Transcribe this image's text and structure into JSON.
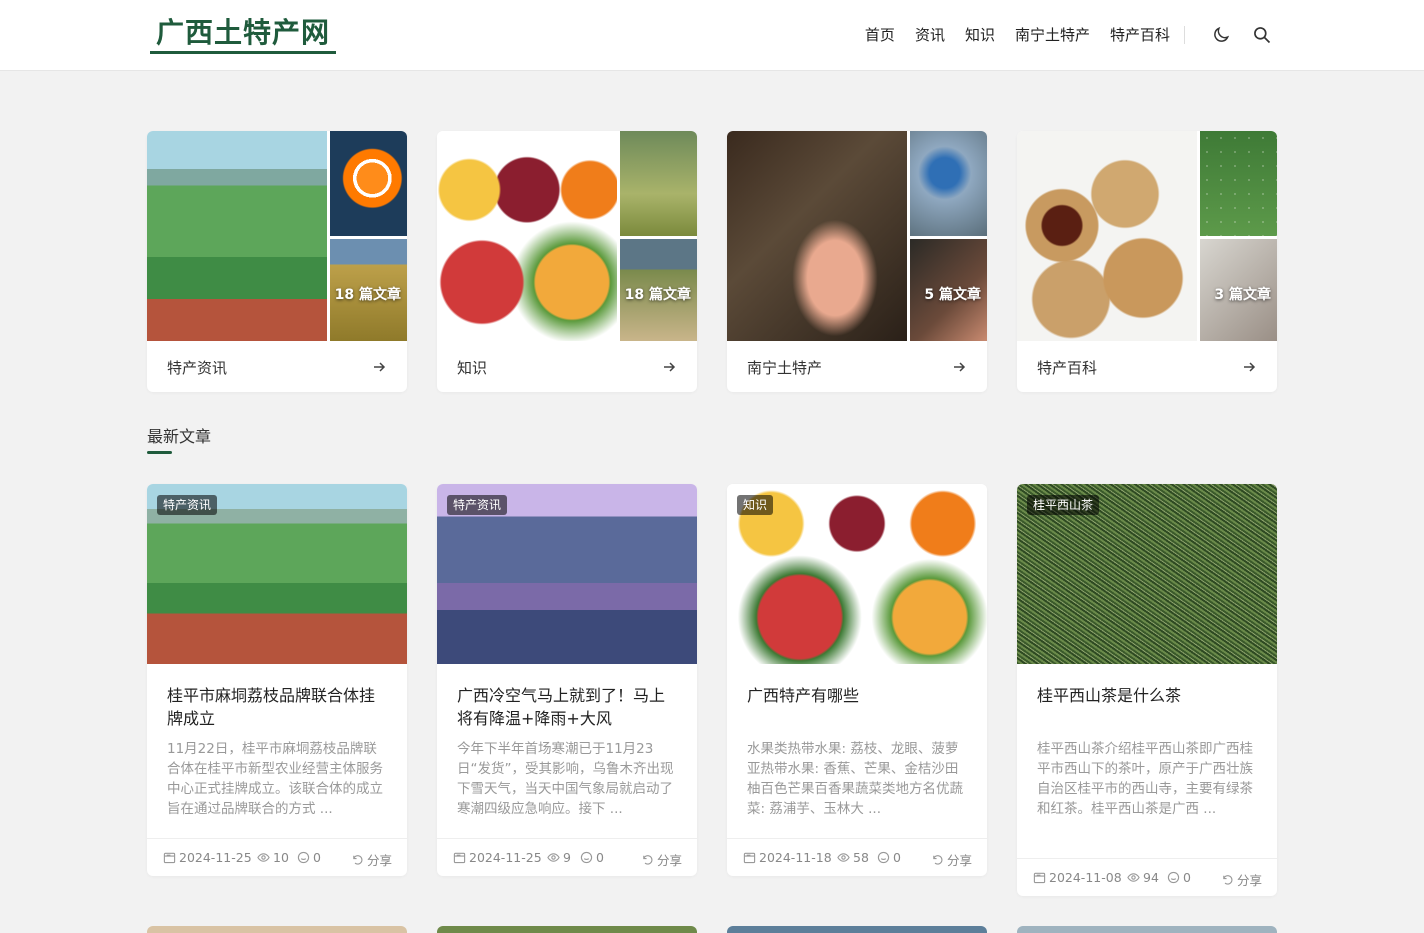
{
  "site": {
    "logo": "广西土特产网",
    "nav": [
      "首页",
      "资讯",
      "知识",
      "南宁土特产",
      "特产百科"
    ],
    "icons": [
      "moon-icon",
      "search-icon"
    ]
  },
  "categories": [
    {
      "name": "特产资讯",
      "count": "18 篇文章"
    },
    {
      "name": "知识",
      "count": "18 篇文章"
    },
    {
      "name": "南宁土特产",
      "count": "5 篇文章"
    },
    {
      "name": "特产百科",
      "count": "3 篇文章"
    }
  ],
  "latest": {
    "title": "最新文章",
    "articles": [
      {
        "tag": "特产资讯",
        "title": "桂平市麻垌荔枝品牌联合体挂牌成立",
        "excerpt": "11月22日，桂平市麻垌荔枝品牌联合体在桂平市新型农业经营主体服务中心正式挂牌成立。该联合体的成立旨在通过品牌联合的方式 ...",
        "date": "2024-11-25",
        "views": "10",
        "comments": "0",
        "share": "分享"
      },
      {
        "tag": "特产资讯",
        "title": "广西冷空气马上就到了！马上将有降温+降雨+大风",
        "excerpt": "今年下半年首场寒潮已于11月23日“发货”，受其影响，乌鲁木齐出现下雪天气，当天中国气象局就启动了寒潮四级应急响应。接下 ...",
        "date": "2024-11-25",
        "views": "9",
        "comments": "0",
        "share": "分享"
      },
      {
        "tag": "知识",
        "title": "广西特产有哪些",
        "excerpt": "水果类热带水果: 荔枝、龙眼、菠萝亚热带水果: 香蕉、芒果、金桔沙田柚百色芒果百香果蔬菜类地方名优蔬菜: 荔浦芋、玉林大 ...",
        "date": "2024-11-18",
        "views": "58",
        "comments": "0",
        "share": "分享"
      },
      {
        "tag": "桂平西山茶",
        "title": "桂平西山茶是什么茶",
        "excerpt": "桂平西山茶介绍桂平西山茶即广西桂平市西山下的茶叶，原产于广西壮族自治区桂平市的西山寺，主要有绿茶和红茶。桂平西山茶是广西 ...",
        "date": "2024-11-08",
        "views": "94",
        "comments": "0",
        "share": "分享"
      }
    ]
  },
  "colors": {
    "brand": "#1f5b3c",
    "background": "#f2f2f2"
  }
}
